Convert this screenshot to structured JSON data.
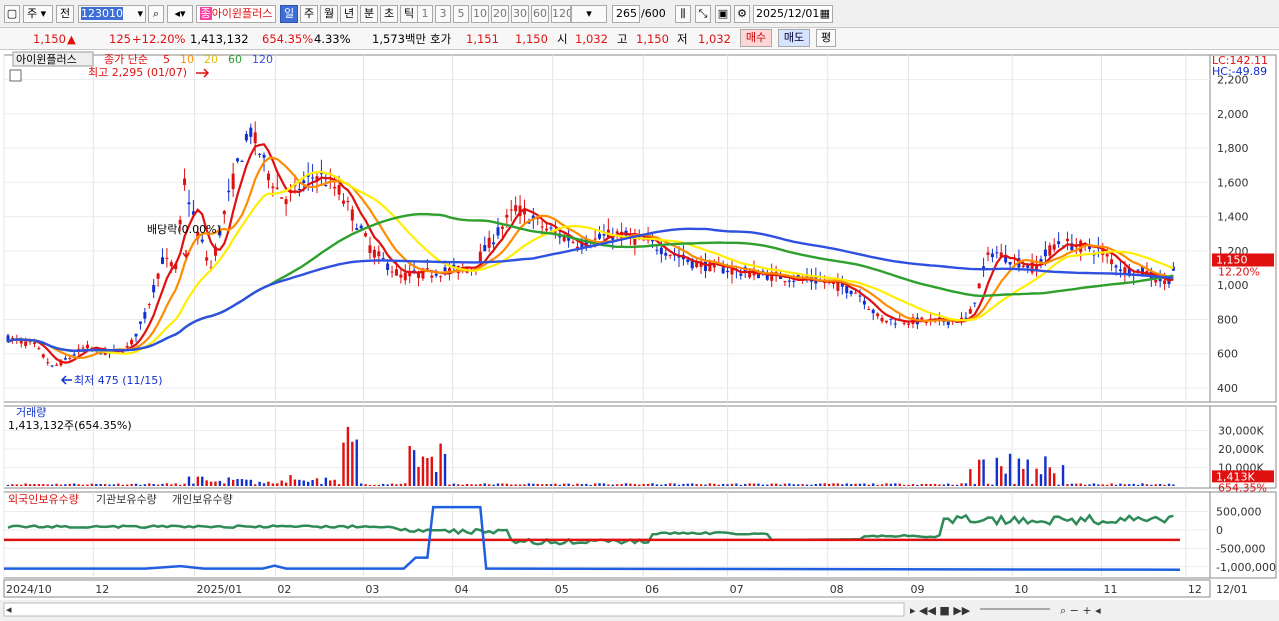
{
  "toolbar": {
    "market": "주",
    "period_mode": "전",
    "code": "123010",
    "stock_name": "아이윈플러스",
    "periods": [
      "일",
      "주",
      "월",
      "년",
      "분",
      "초",
      "틱"
    ],
    "minutes": [
      "1",
      "3",
      "5",
      "10",
      "20",
      "30",
      "60",
      "120"
    ],
    "count": "265",
    "max_count": "/600",
    "date": "2025/12/01"
  },
  "quote": {
    "price": "1,150",
    "arrow": "▲",
    "change": "125",
    "change_pct": "+12.20%",
    "volume": "1,413,132",
    "volume_pct": "654.35%",
    "turnover": "4.33%",
    "amount": "1,573백만",
    "hoga_label": "호가",
    "ask": "1,151",
    "bid": "1,150",
    "open_label": "시",
    "open": "1,032",
    "high_label": "고",
    "high": "1,150",
    "low_label": "저",
    "low": "1,032",
    "buy_btn": "매수",
    "sell_btn": "매도",
    "eval_btn": "평"
  },
  "price_panel": {
    "name": "아이윈플러스",
    "ma_label": "종가 단순",
    "ma_periods": [
      "5",
      "10",
      "20",
      "60",
      "120"
    ],
    "ma_colors": [
      "#e01010",
      "#ff8c00",
      "#ffee00",
      "#2ea02e",
      "#3050e0"
    ],
    "max_note": "최고 2,295 (01/07)",
    "min_note": "최저 475 (11/15)",
    "dividend_note": "배당락(0.00%)",
    "lc": "LC:142.11",
    "hc": "HC:-49.89",
    "last_tag": "1,150",
    "pct_tag": "12.20%",
    "y_ticks": [
      "2,200",
      "2,000",
      "1,800",
      "1,600",
      "1,400",
      "1,200",
      "1,000",
      "800",
      "600",
      "400"
    ]
  },
  "volume_panel": {
    "title": "거래량",
    "value": "1,413,132주(654.35%)",
    "y_ticks": [
      "30,000K",
      "20,000K",
      "10,000K"
    ],
    "last_tag": "1,413K",
    "pct_tag": "654.35%"
  },
  "holding_panel": {
    "series": [
      "외국인보유수량",
      "기관보유수량",
      "개인보유수량"
    ],
    "y_ticks": [
      "500,000",
      "0",
      "-500,000",
      "-1,000,000"
    ]
  },
  "x_axis": [
    "2024/10",
    "12",
    "2025/01",
    "02",
    "03",
    "04",
    "05",
    "06",
    "07",
    "08",
    "09",
    "10",
    "11",
    "12",
    "12/01"
  ],
  "colors": {
    "up": "#e01010",
    "down": "#1030d0",
    "foreign": "#2e8b57",
    "inst": "#2060e0",
    "indiv": "#e01010"
  }
}
